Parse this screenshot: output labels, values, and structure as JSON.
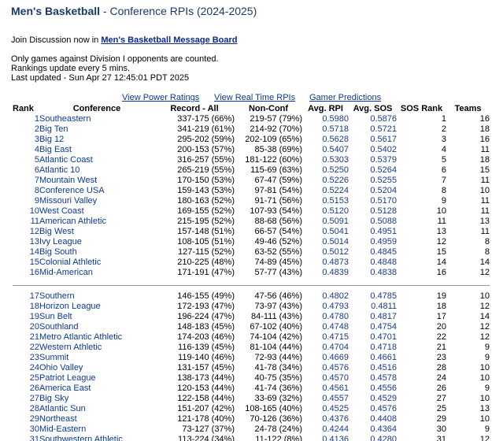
{
  "page": {
    "title_main": "Men's Basketball",
    "title_sub": " - Conference RPIs (2024-2025)"
  },
  "discussion": {
    "prefix": "Join Discussion now in ",
    "link_text": "Men's Basketball Message Board"
  },
  "info": {
    "line1": "Only games against Division I opponents are counted.",
    "line2": "Rankings update every 5 mins.",
    "line3": "Last updated - Sun Apr 27 12:45:01 PDT 2025"
  },
  "links": {
    "power": "View Power Ratings",
    "realtime": "View Real Time RPIs",
    "gamer": "Gamer Predictions"
  },
  "table": {
    "headers": [
      "Rank",
      "Conference",
      "Record - All",
      "Non-Conf",
      "Avg. RPI",
      "Avg. SOS",
      "SOS Rank",
      "Teams"
    ],
    "group1": [
      [
        "1",
        "Southeastern",
        "337-175 (66%)",
        "219-57 (79%)",
        "0.5980",
        "0.5876",
        "1",
        "16"
      ],
      [
        "2",
        "Big Ten",
        "341-219 (61%)",
        "214-92 (70%)",
        "0.5718",
        "0.5721",
        "2",
        "18"
      ],
      [
        "3",
        "Big 12",
        "295-202 (59%)",
        "202-109 (65%)",
        "0.5628",
        "0.5617",
        "3",
        "16"
      ],
      [
        "4",
        "Big East",
        "200-153 (57%)",
        "85-38 (69%)",
        "0.5407",
        "0.5402",
        "4",
        "11"
      ],
      [
        "5",
        "Atlantic Coast",
        "316-257 (55%)",
        "181-122 (60%)",
        "0.5303",
        "0.5379",
        "5",
        "18"
      ],
      [
        "6",
        "Atlantic 10",
        "265-219 (55%)",
        "115-69 (63%)",
        "0.5250",
        "0.5264",
        "6",
        "15"
      ],
      [
        "7",
        "Mountain West",
        "170-150 (53%)",
        "67-47 (59%)",
        "0.5226",
        "0.5255",
        "7",
        "11"
      ],
      [
        "8",
        "Conference USA",
        "159-143 (53%)",
        "97-81 (54%)",
        "0.5224",
        "0.5204",
        "8",
        "10"
      ],
      [
        "9",
        "Missouri Valley",
        "180-163 (52%)",
        "91-71 (56%)",
        "0.5153",
        "0.5170",
        "9",
        "11"
      ],
      [
        "10",
        "West Coast",
        "169-155 (52%)",
        "107-93 (54%)",
        "0.5120",
        "0.5128",
        "10",
        "11"
      ],
      [
        "11",
        "American Athletic",
        "215-195 (52%)",
        "88-68 (56%)",
        "0.5091",
        "0.5088",
        "11",
        "13"
      ],
      [
        "12",
        "Big West",
        "157-148 (51%)",
        "66-57 (54%)",
        "0.5041",
        "0.4951",
        "13",
        "11"
      ],
      [
        "13",
        "Ivy League",
        "108-105 (51%)",
        "49-46 (52%)",
        "0.5014",
        "0.4959",
        "12",
        "8"
      ],
      [
        "14",
        "Big South",
        "127-115 (52%)",
        "63-52 (55%)",
        "0.5012",
        "0.4845",
        "15",
        "8"
      ],
      [
        "15",
        "Colonial Athletic",
        "210-225 (48%)",
        "74-89 (45%)",
        "0.4873",
        "0.4848",
        "14",
        "14"
      ],
      [
        "16",
        "Mid-American",
        "171-191 (47%)",
        "57-77 (43%)",
        "0.4839",
        "0.4838",
        "16",
        "12"
      ]
    ],
    "group2": [
      [
        "17",
        "Southern",
        "146-155 (49%)",
        "47-56 (46%)",
        "0.4802",
        "0.4785",
        "19",
        "10"
      ],
      [
        "18",
        "Horizon League",
        "172-193 (47%)",
        "73-97 (43%)",
        "0.4793",
        "0.4811",
        "18",
        "12"
      ],
      [
        "19",
        "Sun Belt",
        "196-224 (47%)",
        "84-111 (43%)",
        "0.4780",
        "0.4817",
        "17",
        "14"
      ],
      [
        "20",
        "Southland",
        "148-183 (45%)",
        "67-102 (40%)",
        "0.4748",
        "0.4754",
        "20",
        "12"
      ],
      [
        "21",
        "Metro Atlantic Athletic",
        "174-203 (46%)",
        "74-104 (42%)",
        "0.4715",
        "0.4701",
        "22",
        "12"
      ],
      [
        "22",
        "Western Athletic",
        "116-139 (45%)",
        "81-104 (44%)",
        "0.4704",
        "0.4718",
        "21",
        "9"
      ],
      [
        "23",
        "Summit",
        "119-140 (46%)",
        "72-93 (44%)",
        "0.4669",
        "0.4661",
        "23",
        "9"
      ],
      [
        "24",
        "Ohio Valley",
        "131-157 (45%)",
        "41-78 (34%)",
        "0.4576",
        "0.4516",
        "28",
        "10"
      ],
      [
        "25",
        "Patriot League",
        "138-173 (44%)",
        "40-75 (35%)",
        "0.4570",
        "0.4578",
        "24",
        "10"
      ],
      [
        "26",
        "America East",
        "120-153 (44%)",
        "41-74 (36%)",
        "0.4561",
        "0.4556",
        "26",
        "9"
      ],
      [
        "27",
        "Big Sky",
        "122-158 (44%)",
        "33-69 (32%)",
        "0.4557",
        "0.4529",
        "27",
        "10"
      ],
      [
        "28",
        "Atlantic Sun",
        "151-207 (42%)",
        "108-165 (40%)",
        "0.4525",
        "0.4576",
        "25",
        "13"
      ],
      [
        "29",
        "Northeast",
        "121-178 (40%)",
        "70-126 (36%)",
        "0.4376",
        "0.4408",
        "29",
        "10"
      ],
      [
        "30",
        "Mid-Eastern",
        "73-127 (37%)",
        "24-78 (24%)",
        "0.4244",
        "0.4364",
        "30",
        "9"
      ],
      [
        "31",
        "Southwestern Athletic",
        "113-224 (34%)",
        "11-122 (8%)",
        "0.4136",
        "0.4280",
        "31",
        "12"
      ]
    ]
  }
}
